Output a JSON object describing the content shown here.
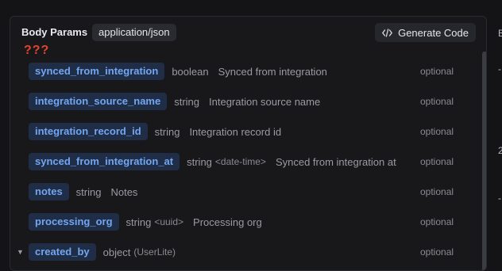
{
  "header": {
    "title": "Body Params",
    "content_type": "application/json",
    "generate_label": "Generate Code"
  },
  "error_marker": "???",
  "params": [
    {
      "name": "synced_from_integration",
      "type": "boolean",
      "format": "",
      "description": "Synced from integration",
      "optional": "optional"
    },
    {
      "name": "integration_source_name",
      "type": "string",
      "format": "",
      "description": "Integration source name",
      "optional": "optional"
    },
    {
      "name": "integration_record_id",
      "type": "string",
      "format": "",
      "description": "Integration record id",
      "optional": "optional"
    },
    {
      "name": "synced_from_integration_at",
      "type": "string",
      "format": "<date-time>",
      "description": "Synced from integration at",
      "optional": "optional"
    },
    {
      "name": "notes",
      "type": "string",
      "format": "",
      "description": "Notes",
      "optional": "optional"
    },
    {
      "name": "processing_org",
      "type": "string",
      "format": "<uuid>",
      "description": "Processing org",
      "optional": "optional"
    },
    {
      "name": "created_by",
      "type": "object",
      "format": "(UserLite)",
      "description": "",
      "optional": "optional",
      "expandable": true
    }
  ],
  "side_chars": [
    "B",
    "-",
    "2",
    "-"
  ]
}
